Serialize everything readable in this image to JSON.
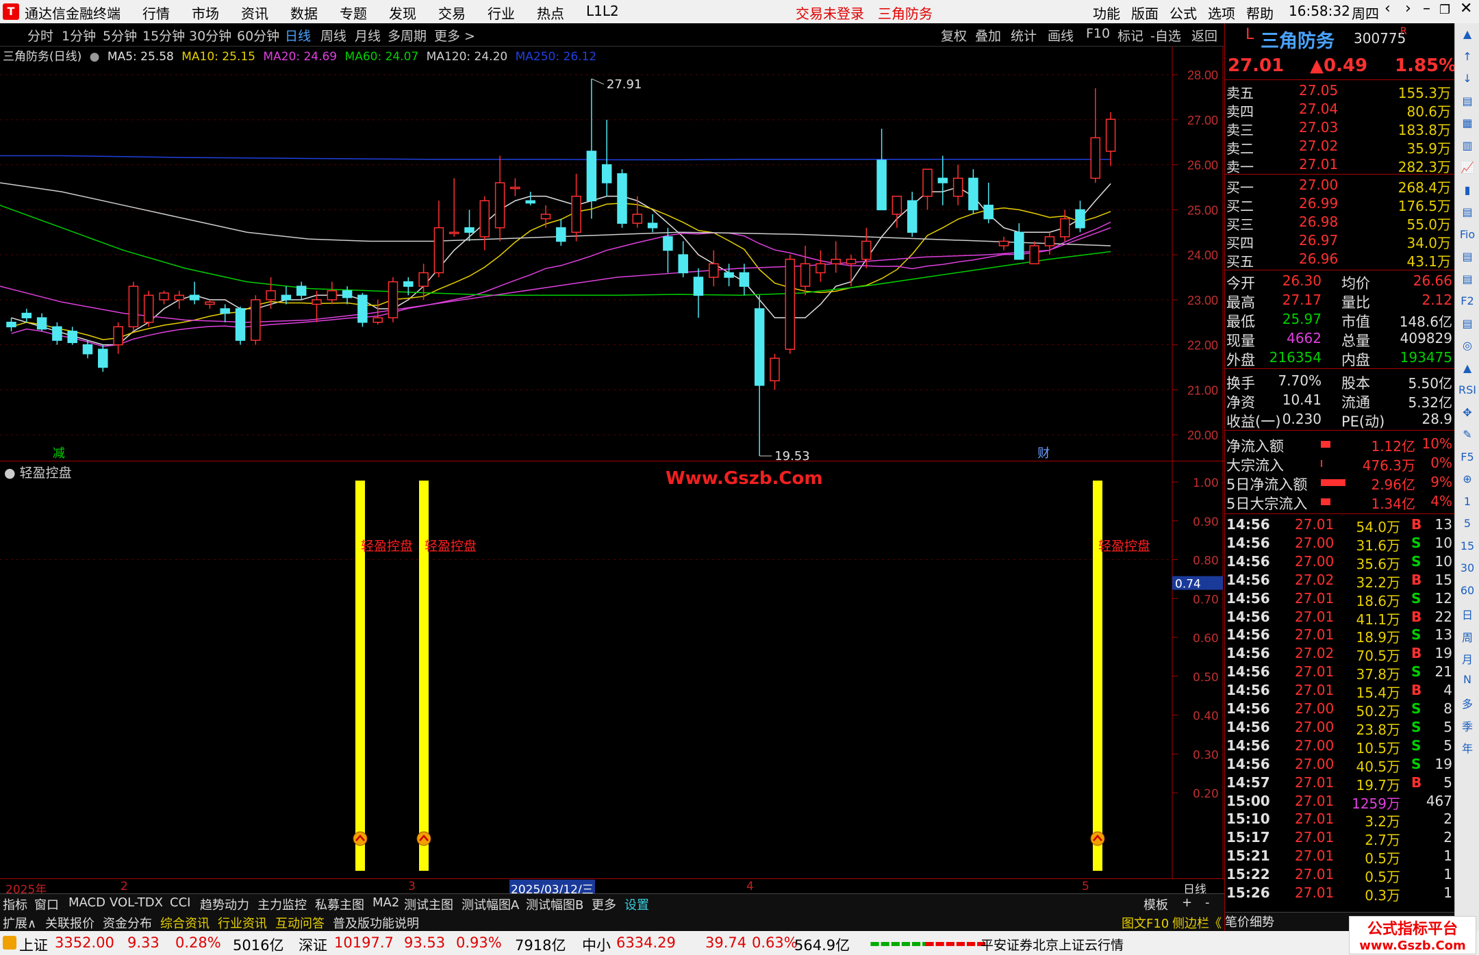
{
  "menubar": {
    "app_title": "通达信金融终端",
    "items": [
      "行情",
      "市场",
      "资讯",
      "数据",
      "专题",
      "发现",
      "交易",
      "行业",
      "热点",
      "L1L2"
    ],
    "notice": "交易未登录",
    "stock": "三角防务",
    "right_items": [
      "功能",
      "版面",
      "公式",
      "选项",
      "帮助"
    ],
    "time": "16:58:32",
    "weekday": "周四",
    "logo": "T"
  },
  "toolbar": {
    "periods": [
      "分时",
      "1分钟",
      "5分钟",
      "15分钟",
      "30分钟",
      "60分钟",
      "日线",
      "周线",
      "月线",
      "多周期",
      "更多 >"
    ],
    "active": "日线",
    "right": [
      "复权",
      "叠加",
      "统计",
      "画线",
      "F10",
      "标记",
      "-自选",
      "返回"
    ]
  },
  "kinfo": {
    "title": "三角防务(日线)",
    "ma": [
      {
        "label": "MA5: 25.58",
        "color": "#e0e0e0"
      },
      {
        "label": "MA10: 25.15",
        "color": "#e8d000"
      },
      {
        "label": "MA20: 24.69",
        "color": "#e040e0"
      },
      {
        "label": "MA60: 24.07",
        "color": "#00d000"
      },
      {
        "label": "MA120: 24.20",
        "color": "#cfcfcf"
      },
      {
        "label": "MA250: 26.12",
        "color": "#2040e0"
      }
    ]
  },
  "chart_data": [
    {
      "type": "candlestick",
      "title": "三角防务(日线)",
      "ylim": [
        19.5,
        28.2
      ],
      "y_ticks": [
        "28.00",
        "27.00",
        "26.00",
        "25.00",
        "24.00",
        "23.00",
        "22.00",
        "21.00",
        "20.00"
      ],
      "high_label": "27.91",
      "low_label": "19.53",
      "markers": [
        "减",
        "财"
      ],
      "candles": [
        [
          22.5,
          22.6,
          22.3,
          22.4
        ],
        [
          22.7,
          22.8,
          22.5,
          22.6
        ],
        [
          22.6,
          22.7,
          22.3,
          22.35
        ],
        [
          22.4,
          22.5,
          22.0,
          22.1
        ],
        [
          22.3,
          22.4,
          22.0,
          22.05
        ],
        [
          22.0,
          22.1,
          21.7,
          21.8
        ],
        [
          21.9,
          22.0,
          21.4,
          21.5
        ],
        [
          22.0,
          22.5,
          21.8,
          22.4
        ],
        [
          22.4,
          23.4,
          22.3,
          23.3
        ],
        [
          22.5,
          23.2,
          22.4,
          23.1
        ],
        [
          23.0,
          23.2,
          22.9,
          23.15
        ],
        [
          23.0,
          23.2,
          22.8,
          23.1
        ],
        [
          23.1,
          23.4,
          22.9,
          23.0
        ],
        [
          22.9,
          23.0,
          22.8,
          22.95
        ],
        [
          22.8,
          22.9,
          22.5,
          22.7
        ],
        [
          22.8,
          22.85,
          22.0,
          22.1
        ],
        [
          22.1,
          23.1,
          22.0,
          23.0
        ],
        [
          23.0,
          23.5,
          22.8,
          23.2
        ],
        [
          23.1,
          23.3,
          22.9,
          23.0
        ],
        [
          23.3,
          23.4,
          23.0,
          23.1
        ],
        [
          22.9,
          23.2,
          22.5,
          23.0
        ],
        [
          23.0,
          23.4,
          22.9,
          23.2
        ],
        [
          23.2,
          23.3,
          22.9,
          23.05
        ],
        [
          23.1,
          23.15,
          22.4,
          22.5
        ],
        [
          22.5,
          23.0,
          22.45,
          22.6
        ],
        [
          22.6,
          23.5,
          22.5,
          23.4
        ],
        [
          23.4,
          23.5,
          23.1,
          23.3
        ],
        [
          23.3,
          23.8,
          23.0,
          23.6
        ],
        [
          23.6,
          25.2,
          23.5,
          24.6
        ],
        [
          24.5,
          25.7,
          24.4,
          24.5
        ],
        [
          24.6,
          25.0,
          24.3,
          24.5
        ],
        [
          24.4,
          25.3,
          24.1,
          25.2
        ],
        [
          24.6,
          26.2,
          24.3,
          25.6
        ],
        [
          25.5,
          25.7,
          25.3,
          25.5
        ],
        [
          25.2,
          25.4,
          25.1,
          25.15
        ],
        [
          24.8,
          25.1,
          24.6,
          24.9
        ],
        [
          24.6,
          24.8,
          24.2,
          24.3
        ],
        [
          24.5,
          25.8,
          24.3,
          25.3
        ],
        [
          26.3,
          27.91,
          24.8,
          25.2
        ],
        [
          26.0,
          27.0,
          25.3,
          25.6
        ],
        [
          25.8,
          25.9,
          24.6,
          24.7
        ],
        [
          24.7,
          25.3,
          24.6,
          24.9
        ],
        [
          24.7,
          24.9,
          24.5,
          24.6
        ],
        [
          24.4,
          24.6,
          23.6,
          24.1
        ],
        [
          24.0,
          24.3,
          23.5,
          23.6
        ],
        [
          23.5,
          23.7,
          22.6,
          23.1
        ],
        [
          23.5,
          24.1,
          23.3,
          23.8
        ],
        [
          23.6,
          23.8,
          23.3,
          23.5
        ],
        [
          23.6,
          23.8,
          23.1,
          23.3
        ],
        [
          22.8,
          23.1,
          19.53,
          21.1
        ],
        [
          21.2,
          21.8,
          21.0,
          21.7
        ],
        [
          21.9,
          24.0,
          21.8,
          23.9
        ],
        [
          23.3,
          24.2,
          23.1,
          23.8
        ],
        [
          23.6,
          24.1,
          23.4,
          23.8
        ],
        [
          23.8,
          24.3,
          23.6,
          23.9
        ],
        [
          23.8,
          24.0,
          23.3,
          23.9
        ],
        [
          23.9,
          24.6,
          23.7,
          24.3
        ],
        [
          26.1,
          26.8,
          25.0,
          25.0
        ],
        [
          24.9,
          25.3,
          24.6,
          25.3
        ],
        [
          25.2,
          25.4,
          24.4,
          24.5
        ],
        [
          25.3,
          25.9,
          25.0,
          25.9
        ],
        [
          25.7,
          26.2,
          25.1,
          25.6
        ],
        [
          25.3,
          26.0,
          25.1,
          25.7
        ],
        [
          25.7,
          25.9,
          24.9,
          25.0
        ],
        [
          25.1,
          25.6,
          24.7,
          24.8
        ],
        [
          24.2,
          24.4,
          24.1,
          24.3
        ],
        [
          24.5,
          24.7,
          23.9,
          23.9
        ],
        [
          23.8,
          24.3,
          23.8,
          24.2
        ],
        [
          24.2,
          24.5,
          24.0,
          24.4
        ],
        [
          24.4,
          25.0,
          24.3,
          24.8
        ],
        [
          25.0,
          25.2,
          24.5,
          24.6
        ],
        [
          25.7,
          27.7,
          25.6,
          26.6
        ],
        [
          26.3,
          27.17,
          25.97,
          27.01
        ]
      ],
      "ma_series": {
        "MA5": [
          22.6,
          22.5,
          22.4,
          22.3,
          22.2,
          22.1,
          22.0,
          22.0,
          22.3,
          22.5,
          22.8,
          23.0,
          23.1,
          23.0,
          23.0,
          22.8,
          22.8,
          22.9,
          23.0,
          23.0,
          23.1,
          23.1,
          23.1,
          23.0,
          22.8,
          22.8,
          23.0,
          23.3,
          23.7,
          24.1,
          24.4,
          24.7,
          25.0,
          25.2,
          25.3,
          25.3,
          25.2,
          25.1,
          25.2,
          25.3,
          25.3,
          25.2,
          25.0,
          24.7,
          24.4,
          24.0,
          23.8,
          23.6,
          23.4,
          23.0,
          22.6,
          22.6,
          22.6,
          22.9,
          23.3,
          23.4,
          23.9,
          24.4,
          24.8,
          25.1,
          25.4,
          25.4,
          25.5,
          25.3,
          24.9,
          24.6,
          24.5,
          24.5,
          24.5,
          24.6,
          24.8,
          25.2,
          25.58
        ]
      }
    },
    {
      "type": "bar",
      "title": "轻盈控盘",
      "ylim": [
        0.1,
        1.05
      ],
      "y_ticks": [
        "1.00",
        "0.90",
        "0.80",
        "0.70",
        "0.60",
        "0.50",
        "0.40",
        "0.30",
        "0.20"
      ],
      "current": "0.74",
      "signals": [
        {
          "label": "轻盈控盘",
          "value": 1.0
        },
        {
          "label": "轻盈控盘",
          "value": 1.0
        },
        {
          "label": "轻盈控盘",
          "value": 1.0
        }
      ]
    }
  ],
  "indicator": {
    "title": "轻盈控盘",
    "watermark": "Www.Gszb.Com"
  },
  "xaxis": {
    "labels": [
      "2025年",
      "2",
      "3",
      "2025/03/12/三",
      "4",
      "5"
    ],
    "right": "日线"
  },
  "tabs": [
    "指标",
    "窗口",
    "MACD",
    "VOL-TDX",
    "CCI",
    "趋势动力",
    "主力监控",
    "私募主图",
    "MA2",
    "测试主图",
    "测试幅图A",
    "测试幅图B",
    "更多",
    "设置",
    "模板",
    "+",
    "-"
  ],
  "tabs2": [
    "扩展∧",
    "关联报价",
    "资金分布",
    "综合资讯",
    "行业资讯",
    "互动问答",
    "普及版功能说明",
    "图文F10",
    "侧边栏《"
  ],
  "quote": {
    "flag": "L",
    "name": "三角防务",
    "code": "300775",
    "badge": "R",
    "price": "27.01",
    "change": "▲0.49",
    "pct": "1.85%",
    "asks": [
      {
        "l": "卖五",
        "p": "27.05",
        "v": "155.3万"
      },
      {
        "l": "卖四",
        "p": "27.04",
        "v": "80.6万"
      },
      {
        "l": "卖三",
        "p": "27.03",
        "v": "183.8万"
      },
      {
        "l": "卖二",
        "p": "27.02",
        "v": "35.9万"
      },
      {
        "l": "卖一",
        "p": "27.01",
        "v": "282.3万"
      }
    ],
    "bids": [
      {
        "l": "买一",
        "p": "27.00",
        "v": "268.4万"
      },
      {
        "l": "买二",
        "p": "26.99",
        "v": "176.5万"
      },
      {
        "l": "买三",
        "p": "26.98",
        "v": "55.0万"
      },
      {
        "l": "买四",
        "p": "26.97",
        "v": "34.0万"
      },
      {
        "l": "买五",
        "p": "26.96",
        "v": "43.1万"
      }
    ],
    "stats": [
      [
        "今开",
        "26.30",
        "均价",
        "26.66"
      ],
      [
        "最高",
        "27.17",
        "量比",
        "2.12"
      ],
      [
        "最低",
        "25.97",
        "市值",
        "148.6亿"
      ],
      [
        "现量",
        "4662",
        "总量",
        "409829"
      ],
      [
        "外盘",
        "216354",
        "内盘",
        "193475"
      ],
      [
        "换手",
        "7.70%",
        "股本",
        "5.50亿"
      ],
      [
        "净资",
        "10.41",
        "流通",
        "5.32亿"
      ],
      [
        "收益(一)",
        "0.230",
        "PE(动)",
        "28.9"
      ]
    ],
    "flows": [
      [
        "净流入额",
        "1.12亿",
        "10%"
      ],
      [
        "大宗流入",
        "476.3万",
        "0%"
      ],
      [
        "5日净流入额",
        "2.96亿",
        "9%"
      ],
      [
        "5日大宗流入",
        "1.34亿",
        "4%"
      ]
    ],
    "ticks": [
      [
        "14:56",
        "27.01",
        "54.0万",
        "B",
        "13"
      ],
      [
        "14:56",
        "27.00",
        "31.6万",
        "S",
        "10"
      ],
      [
        "14:56",
        "27.00",
        "35.6万",
        "S",
        "10"
      ],
      [
        "14:56",
        "27.02",
        "32.2万",
        "B",
        "15"
      ],
      [
        "14:56",
        "27.01",
        "18.6万",
        "S",
        "12"
      ],
      [
        "14:56",
        "27.01",
        "41.1万",
        "B",
        "22"
      ],
      [
        "14:56",
        "27.01",
        "18.9万",
        "S",
        "13"
      ],
      [
        "14:56",
        "27.02",
        "70.5万",
        "B",
        "19"
      ],
      [
        "14:56",
        "27.01",
        "37.8万",
        "S",
        "21"
      ],
      [
        "14:56",
        "27.01",
        "15.4万",
        "B",
        "4"
      ],
      [
        "14:56",
        "27.00",
        "50.2万",
        "S",
        "8"
      ],
      [
        "14:56",
        "27.00",
        "23.8万",
        "S",
        "5"
      ],
      [
        "14:56",
        "27.00",
        "10.5万",
        "S",
        "5"
      ],
      [
        "14:56",
        "27.00",
        "40.5万",
        "S",
        "19"
      ],
      [
        "14:57",
        "27.01",
        "19.7万",
        "B",
        "5"
      ],
      [
        "15:00",
        "27.01",
        "1259万",
        "",
        "467"
      ],
      [
        "15:10",
        "27.01",
        "3.2万",
        "",
        "2"
      ],
      [
        "15:17",
        "27.01",
        "2.7万",
        "",
        "2"
      ],
      [
        "15:21",
        "27.01",
        "0.5万",
        "",
        "1"
      ],
      [
        "15:22",
        "27.01",
        "0.5万",
        "",
        "1"
      ],
      [
        "15:26",
        "27.01",
        "0.3万",
        "",
        "1"
      ]
    ],
    "bottom_tabs": [
      "笔",
      "价",
      "细",
      "势"
    ]
  },
  "status": {
    "sh_name": "上证",
    "sh": "3352.00",
    "sh_chg": "9.33",
    "sh_pct": "0.28%",
    "sh_amt": "5016亿",
    "sz_name": "深证",
    "sz": "10197.7",
    "sz_chg": "93.53",
    "sz_pct": "0.93%",
    "sz_amt": "7918亿",
    "zx_name": "中小",
    "zx": "6334.29",
    "zx_chg": "39.74",
    "zx_pct": "0.63%",
    "zx_amt": "564.9亿",
    "server": "平安证券北京上证云行情"
  },
  "watermark2": {
    "a": "公式指标平台",
    "b": "www.Gszb.Com"
  },
  "rtools": [
    "▲",
    "↑",
    "↓",
    "▤",
    "▦",
    "▥",
    "📈",
    "▮",
    "▤",
    "Fio",
    "▤",
    "▤",
    "F2",
    "▤",
    "◎",
    "▲",
    "RSI",
    "✥",
    "✎",
    "F5",
    "⊕",
    "1",
    "5",
    "15",
    "30",
    "60",
    "日",
    "周",
    "月",
    "N",
    "多",
    "季",
    "年"
  ]
}
